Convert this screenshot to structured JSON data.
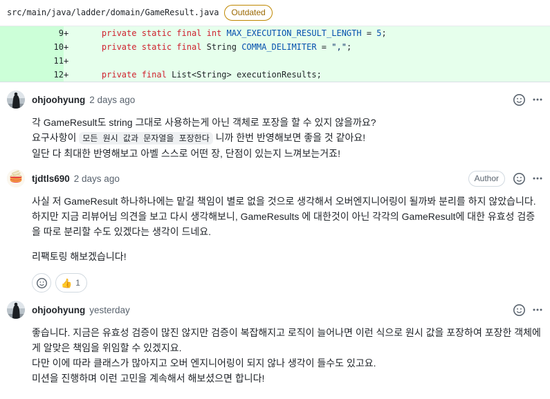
{
  "file": {
    "path": "src/main/java/ladder/domain/GameResult.java",
    "outdated_label": "Outdated"
  },
  "diff": {
    "lines": [
      {
        "number": "9",
        "marker": "+",
        "tokens": [
          {
            "t": "    ",
            "c": "plain"
          },
          {
            "t": "private static final ",
            "c": "kw"
          },
          {
            "t": "int ",
            "c": "kw"
          },
          {
            "t": "MAX_EXECUTION_RESULT_LENGTH ",
            "c": "const"
          },
          {
            "t": "= ",
            "c": "plain"
          },
          {
            "t": "5",
            "c": "num"
          },
          {
            "t": ";",
            "c": "plain"
          }
        ]
      },
      {
        "number": "10",
        "marker": "+",
        "tokens": [
          {
            "t": "    ",
            "c": "plain"
          },
          {
            "t": "private static final ",
            "c": "kw"
          },
          {
            "t": "String ",
            "c": "plain"
          },
          {
            "t": "COMMA_DELIMITER ",
            "c": "const"
          },
          {
            "t": "= ",
            "c": "plain"
          },
          {
            "t": "\",\"",
            "c": "str"
          },
          {
            "t": ";",
            "c": "plain"
          }
        ]
      },
      {
        "number": "11",
        "marker": "+",
        "tokens": [
          {
            "t": "",
            "c": "plain"
          }
        ]
      },
      {
        "number": "12",
        "marker": "+",
        "tokens": [
          {
            "t": "    ",
            "c": "plain"
          },
          {
            "t": "private final ",
            "c": "kw"
          },
          {
            "t": "List<String> ",
            "c": "plain"
          },
          {
            "t": "executionResults",
            "c": "plain"
          },
          {
            "t": ";",
            "c": "plain"
          }
        ]
      }
    ]
  },
  "comments": [
    {
      "author": "ohjoohyung",
      "timestamp": "2 days ago",
      "avatar": "photo-avatar",
      "is_author": false,
      "badge_label": "",
      "paragraphs": [
        {
          "lines": [
            {
              "parts": [
                {
                  "text": "각 GameResult도 string 그대로 사용하는게 아닌 객체로 포장을 할 수 있지 않을까요?",
                  "code": false
                }
              ]
            },
            {
              "parts": [
                {
                  "text": "요구사항이 ",
                  "code": false
                },
                {
                  "text": "모든 원시 값과 문자열을 포장한다",
                  "code": true
                },
                {
                  "text": " 니까 한번 반영해보면 좋을 것 같아요!",
                  "code": false
                }
              ]
            },
            {
              "parts": [
                {
                  "text": "일단 다 최대한 반영해보고 아벨 스스로 어떤 장, 단점이 있는지 느껴보는거죠!",
                  "code": false
                }
              ]
            }
          ]
        }
      ],
      "reactions": []
    },
    {
      "author": "tjdtls690",
      "timestamp": "2 days ago",
      "avatar": "drum-avatar",
      "is_author": true,
      "badge_label": "Author",
      "paragraphs": [
        {
          "lines": [
            {
              "parts": [
                {
                  "text": "사실 저 GameResult 하나하나에는 맡길 책임이 별로 없을 것으로 생각해서 오버엔지니어링이 될까봐 분리를 하지 않았습니다. 하지만 지금 리뷰어님 의견을 보고 다시 생각해보니, GameResults 에 대한것이 아닌 각각의 GameResult에 대한 유효성 검증을 따로 분리할 수도 있겠다는 생각이 드네요.",
                  "code": false
                }
              ]
            }
          ]
        },
        {
          "lines": [
            {
              "parts": [
                {
                  "text": "리팩토링 해보겠습니다!",
                  "code": false
                }
              ]
            }
          ]
        }
      ],
      "reactions": [
        {
          "emoji": "👍",
          "count": "1"
        }
      ]
    },
    {
      "author": "ohjoohyung",
      "timestamp": "yesterday",
      "avatar": "photo-avatar",
      "is_author": false,
      "badge_label": "",
      "paragraphs": [
        {
          "lines": [
            {
              "parts": [
                {
                  "text": "좋습니다. 지금은 유효성 검증이 많진 않지만 검증이 복잡해지고 로직이 늘어나면 이런 식으로 원시 값을 포장하여 포장한 객체에게 알맞은 책임을 위임할 수 있겠지요.",
                  "code": false
                }
              ]
            },
            {
              "parts": [
                {
                  "text": "다만 이에 따라 클래스가 많아지고 오버 엔지니어링이 되지 않나 생각이 들수도 있고요.",
                  "code": false
                }
              ]
            },
            {
              "parts": [
                {
                  "text": "미션을 진행하며 이런 고민을 계속해서 해보셨으면 합니다!",
                  "code": false
                }
              ]
            }
          ]
        }
      ],
      "reactions": []
    }
  ],
  "icons": {
    "add_reaction": "smiley-icon",
    "more_options": "kebab-horizontal-icon"
  },
  "colors": {
    "diff_add_bg": "#e6ffec",
    "diff_add_gutter": "#ccffd8",
    "outdated_border": "#bf8700",
    "outdated_text": "#9a6700",
    "muted_text": "#59636e",
    "code_keyword": "#cf222e",
    "code_constant": "#0550ae",
    "code_string": "#0a3069"
  }
}
